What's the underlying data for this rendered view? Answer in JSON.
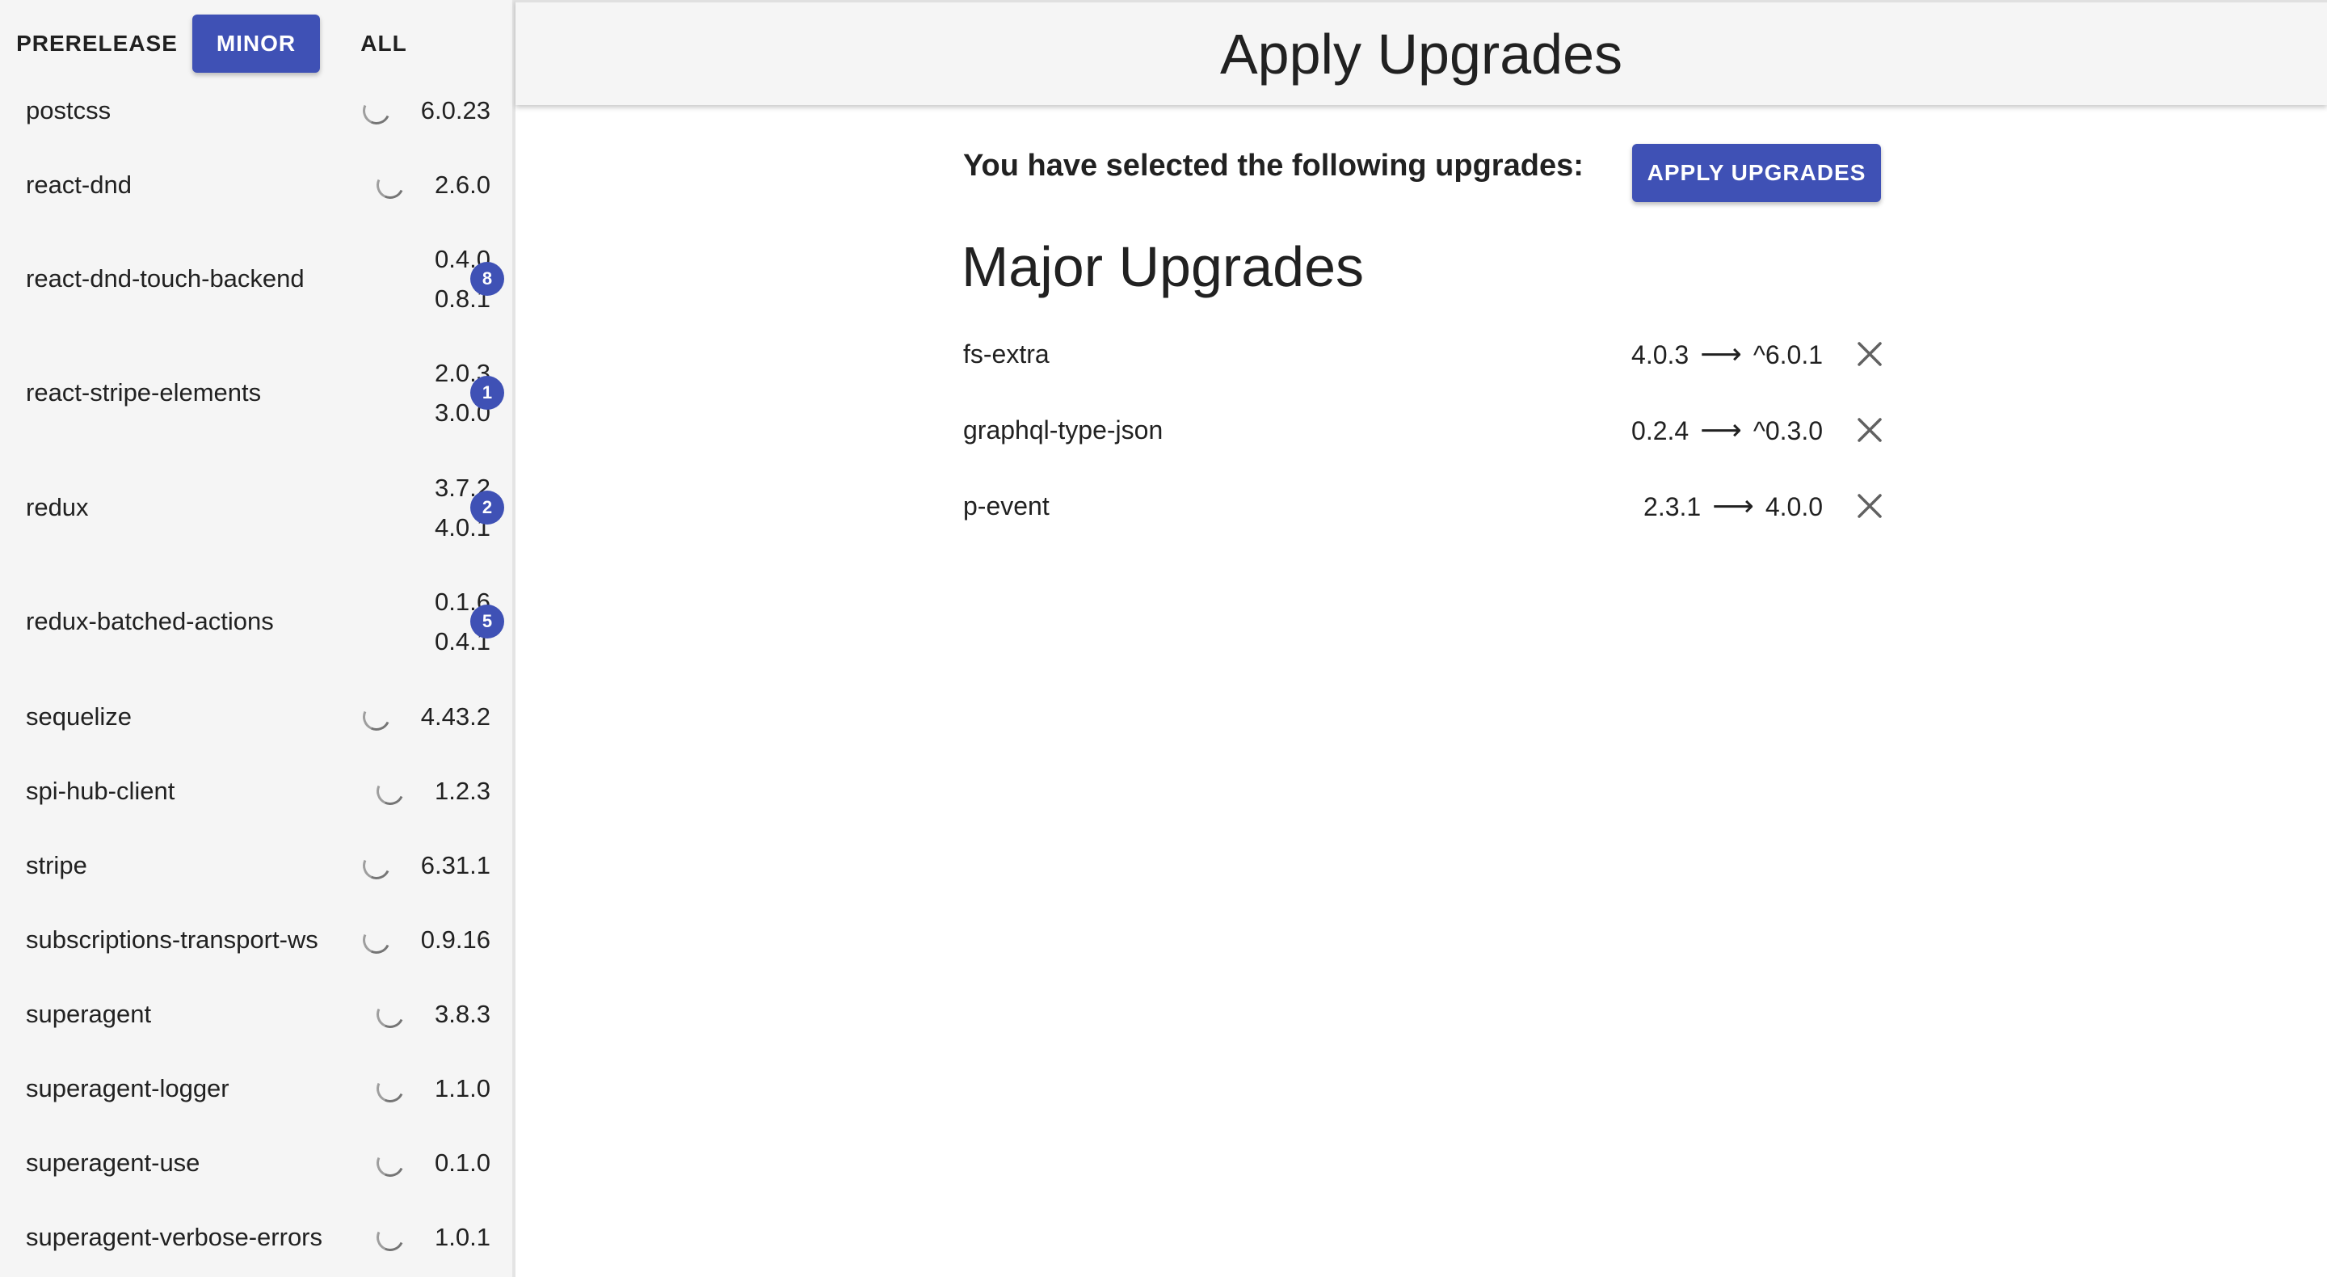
{
  "sidebar": {
    "tabs": [
      {
        "label": "PRERELEASE",
        "active": false
      },
      {
        "label": "MINOR",
        "active": true
      },
      {
        "label": "ALL",
        "active": false
      }
    ],
    "packages": [
      {
        "name": "postcss",
        "version": "6.0.23",
        "icon": "loading-spinner-icon"
      },
      {
        "name": "react-dnd",
        "version": "2.6.0",
        "icon": "loading-spinner-icon"
      },
      {
        "name": "react-dnd-touch-backend",
        "from": "0.4.0",
        "to": "0.8.1",
        "badge": "8"
      },
      {
        "name": "react-stripe-elements",
        "from": "2.0.3",
        "to": "3.0.0",
        "badge": "1"
      },
      {
        "name": "redux",
        "from": "3.7.2",
        "to": "4.0.1",
        "badge": "2"
      },
      {
        "name": "redux-batched-actions",
        "from": "0.1.6",
        "to": "0.4.1",
        "badge": "5"
      },
      {
        "name": "sequelize",
        "version": "4.43.2",
        "icon": "loading-spinner-icon"
      },
      {
        "name": "spi-hub-client",
        "version": "1.2.3",
        "icon": "loading-spinner-icon"
      },
      {
        "name": "stripe",
        "version": "6.31.1",
        "icon": "loading-spinner-icon"
      },
      {
        "name": "subscriptions-transport-ws",
        "version": "0.9.16",
        "icon": "loading-spinner-icon"
      },
      {
        "name": "superagent",
        "version": "3.8.3",
        "icon": "loading-spinner-icon"
      },
      {
        "name": "superagent-logger",
        "version": "1.1.0",
        "icon": "loading-spinner-icon"
      },
      {
        "name": "superagent-use",
        "version": "0.1.0",
        "icon": "loading-spinner-icon"
      },
      {
        "name": "superagent-verbose-errors",
        "version": "1.0.1",
        "icon": "loading-spinner-icon"
      }
    ]
  },
  "header": {
    "title": "Apply Upgrades"
  },
  "main": {
    "prompt": "You have selected the following upgrades:",
    "apply_button": "APPLY UPGRADES",
    "section_title": "Major Upgrades",
    "upgrades": [
      {
        "name": "fs-extra",
        "from": "4.0.3",
        "to": "^6.0.1"
      },
      {
        "name": "graphql-type-json",
        "from": "0.2.4",
        "to": "^0.3.0"
      },
      {
        "name": "p-event",
        "from": "2.3.1",
        "to": "4.0.0"
      }
    ]
  },
  "colors": {
    "accent": "#3f51b5",
    "sidebar_bg": "#f5f5f5"
  }
}
